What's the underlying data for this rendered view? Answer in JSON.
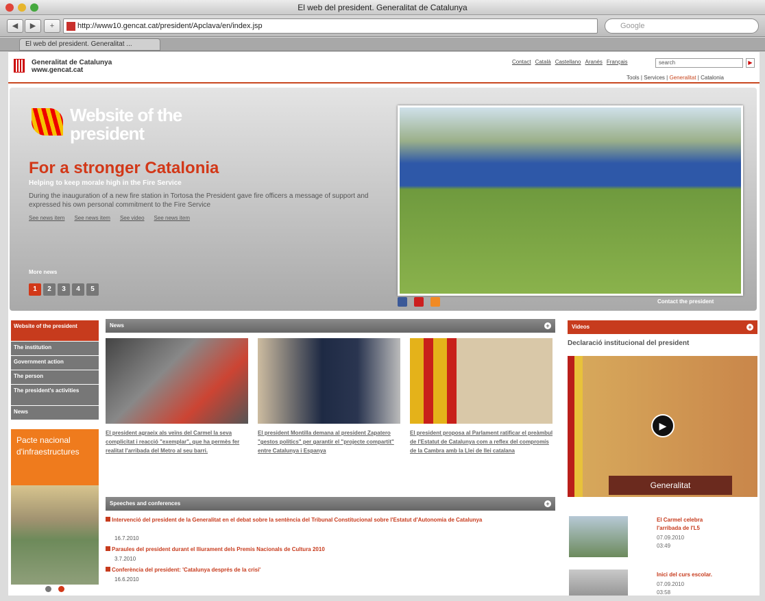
{
  "window": {
    "title": "El web del president. Generalitat de Catalunya"
  },
  "browser": {
    "url": "http://www10.gencat.cat/president/Apclava/en/index.jsp",
    "search_placeholder": "Google",
    "tab": "El web del president. Generalitat ..."
  },
  "site": {
    "brand1": "Generalitat de Catalunya",
    "brand2": "www.gencat.cat",
    "langs": [
      "Contact",
      "Català",
      "Castellano",
      "Aranés",
      "Français"
    ],
    "search": "search",
    "sublinks": [
      "Tools",
      "Services",
      "Generalitat",
      "Catalonia"
    ]
  },
  "hero": {
    "title1": "Website of the",
    "title2": "president",
    "headline": "For a stronger Catalonia",
    "subtitle": "Helping to keep morale high in the Fire Service",
    "desc": "During the inauguration of a new fire station in Tortosa the President gave fire officers a message of support and expressed his own personal commitment to the Fire Service",
    "links": [
      "See news item",
      "See news item",
      "See video",
      "See news item"
    ],
    "more": "More news",
    "pages": [
      "1",
      "2",
      "3",
      "4",
      "5"
    ],
    "contact": "Contact the president"
  },
  "nav": [
    "Website of the president",
    "The institution",
    "Government action",
    "The person",
    "The president's activities",
    "News"
  ],
  "pacte": "Pacte nacional d'infraestructures",
  "news": {
    "label": "News",
    "items": [
      "El president agraeix als veïns del Carmel la seva complicitat i reacció \"exemplar\", que ha permès fer realitat l'arribada del Metro al seu barri.",
      "El president Montilla demana al president Zapatero \"gestos polítics\" per garantir el \"projecte compartit\" entre Catalunya i Espanya",
      "El president proposa al Parlament ratificar el preàmbul de l'Estatut de Catalunya com a reflex del compromís de la Cambra amb la Llei de llei catalana"
    ]
  },
  "speeches": {
    "label": "Speeches and conferences",
    "items": [
      {
        "t": "Intervenció del president de la Generalitat en el debat sobre la sentència del Tribunal Constitucional sobre l'Estatut d'Autonomia de Catalunya",
        "d": "16.7.2010"
      },
      {
        "t": "Paraules del president durant el lliurament dels Premis Nacionals de Cultura 2010",
        "d": "3.7.2010"
      },
      {
        "t": "Conferència del president: 'Catalunya després de la crisi'",
        "d": "16.6.2010"
      }
    ]
  },
  "videos": {
    "label": "Videos",
    "title": "Declaració institucional del president",
    "gen": "Generalitat",
    "items": [
      {
        "t1": "El Carmel celebra",
        "t2": "l'arribada de l'L5",
        "d": "07.09.2010",
        "l": "03:49"
      },
      {
        "t1": "Inici del curs escolar.",
        "t2": "",
        "d": "07.09.2010",
        "l": "03:58"
      }
    ]
  }
}
